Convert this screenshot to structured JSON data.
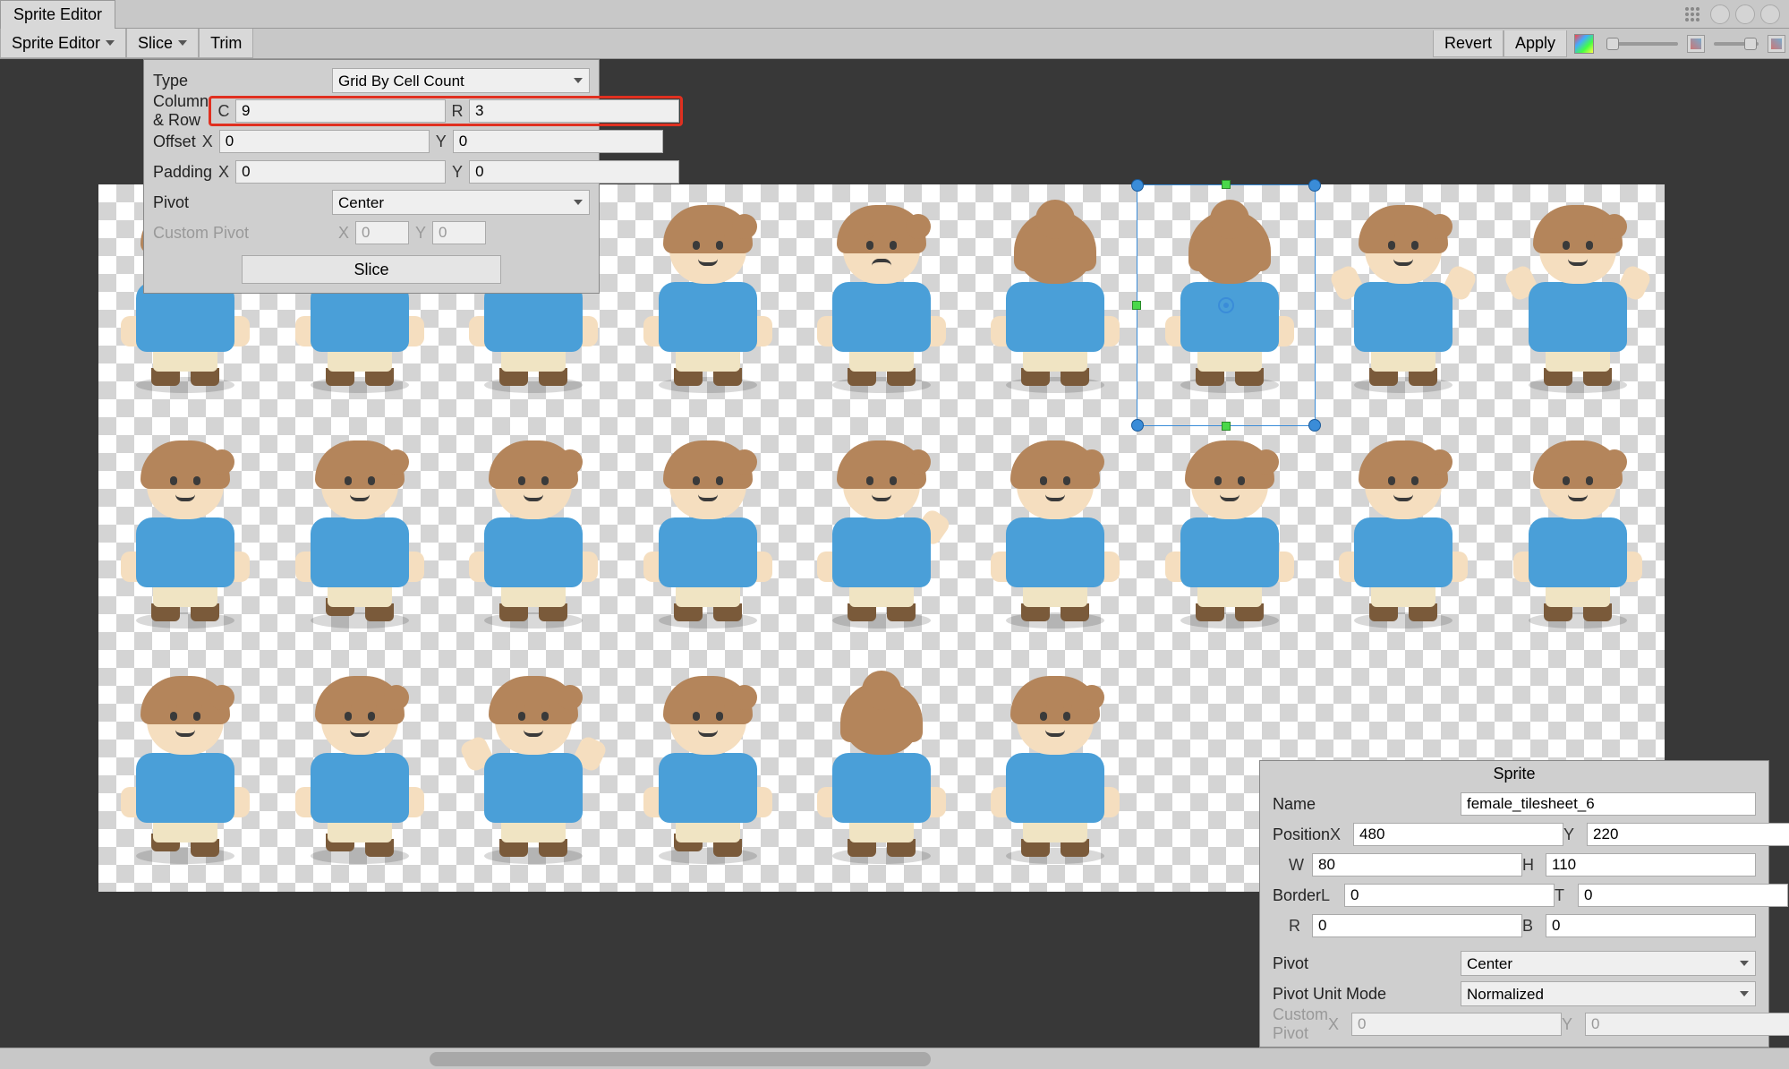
{
  "window": {
    "title": "Sprite Editor"
  },
  "toolbar": {
    "sprite_editor": "Sprite Editor",
    "slice": "Slice",
    "trim": "Trim",
    "revert": "Revert",
    "apply": "Apply"
  },
  "slice_panel": {
    "type_label": "Type",
    "type_value": "Grid By Cell Count",
    "col_row_label": "Column & Row",
    "col_prefix": "C",
    "col_value": "9",
    "row_prefix": "R",
    "row_value": "3",
    "offset_label": "Offset",
    "offset_x_prefix": "X",
    "offset_x": "0",
    "offset_y_prefix": "Y",
    "offset_y": "0",
    "padding_label": "Padding",
    "padding_x_prefix": "X",
    "padding_x": "0",
    "padding_y_prefix": "Y",
    "padding_y": "0",
    "pivot_label": "Pivot",
    "pivot_value": "Center",
    "custom_pivot_label": "Custom Pivot",
    "custom_x_prefix": "X",
    "custom_x": "0",
    "custom_y_prefix": "Y",
    "custom_y": "0",
    "slice_button": "Slice"
  },
  "sprite_panel": {
    "title": "Sprite",
    "name_label": "Name",
    "name_value": "female_tilesheet_6",
    "position_label": "Position",
    "pos_x_prefix": "X",
    "pos_x": "480",
    "pos_y_prefix": "Y",
    "pos_y": "220",
    "pos_w_prefix": "W",
    "pos_w": "80",
    "pos_h_prefix": "H",
    "pos_h": "110",
    "border_label": "Border",
    "border_l_prefix": "L",
    "border_l": "0",
    "border_t_prefix": "T",
    "border_t": "0",
    "border_r_prefix": "R",
    "border_r": "0",
    "border_b_prefix": "B",
    "border_b": "0",
    "pivot_label": "Pivot",
    "pivot_value": "Center",
    "pivot_unit_label": "Pivot Unit Mode",
    "pivot_unit_value": "Normalized",
    "custom_pivot_label": "Custom Pivot",
    "custom_x_prefix": "X",
    "custom_x": "0",
    "custom_y_prefix": "Y",
    "custom_y": "0"
  }
}
